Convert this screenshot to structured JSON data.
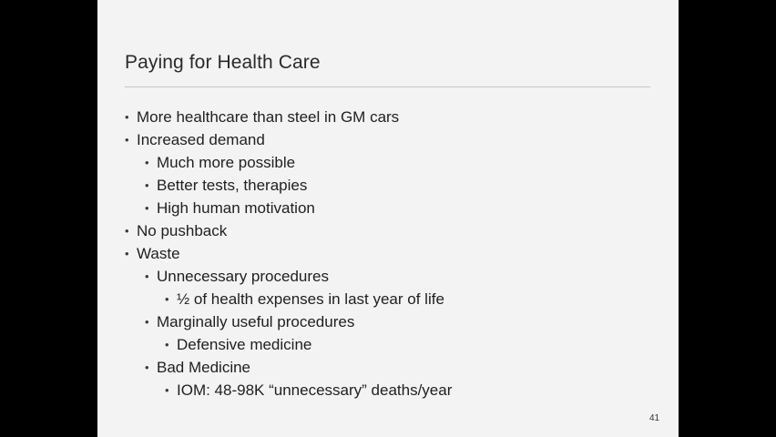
{
  "slide": {
    "title": "Paying for Health Care",
    "page_number": "41",
    "bullet_glyph": "•",
    "bullets": [
      {
        "level": 1,
        "text": "More healthcare than steel in GM cars"
      },
      {
        "level": 1,
        "text": "Increased demand"
      },
      {
        "level": 2,
        "text": "Much more possible"
      },
      {
        "level": 2,
        "text": "Better tests, therapies"
      },
      {
        "level": 2,
        "text": "High human motivation"
      },
      {
        "level": 1,
        "text": "No pushback"
      },
      {
        "level": 1,
        "text": "Waste"
      },
      {
        "level": 2,
        "text": "Unnecessary procedures"
      },
      {
        "level": 3,
        "text": "½ of health expenses in last year of life"
      },
      {
        "level": 2,
        "text": "Marginally useful procedures"
      },
      {
        "level": 3,
        "text": "Defensive medicine"
      },
      {
        "level": 2,
        "text": "Bad Medicine"
      },
      {
        "level": 3,
        "text": "IOM: 48-98K “unnecessary” deaths/year"
      }
    ]
  },
  "colors": {
    "background": "#000000",
    "slide_background": "#f2f3f2",
    "text": "#1f1f1f",
    "rule": "#c4c6c4"
  }
}
